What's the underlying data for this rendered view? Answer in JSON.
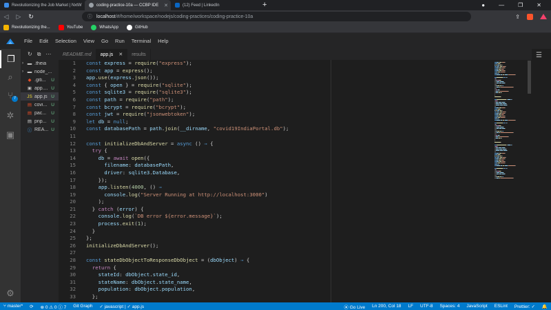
{
  "browser": {
    "tabs": [
      {
        "label": "Revolutionizing the Job Market | NxtW",
        "active": false
      },
      {
        "label": "coding-practice-10a — CCBP IDE",
        "active": true
      },
      {
        "label": "(12) Feed | LinkedIn",
        "active": false
      }
    ],
    "new_tab": "+",
    "url_host": "localhost",
    "url_path": "/#/home/workspace/nodejs/coding-practices/coding-practice-10a",
    "bookmarks": [
      {
        "label": "Revolutionizing the...",
        "color": "#f4b400"
      },
      {
        "label": "YouTube",
        "color": "#ff0000"
      },
      {
        "label": "WhatsApp",
        "color": "#25d366"
      },
      {
        "label": "GitHub",
        "color": "#ffffff"
      }
    ]
  },
  "ide": {
    "menu": [
      "File",
      "Edit",
      "Selection",
      "View",
      "Go",
      "Run",
      "Terminal",
      "Help"
    ],
    "activity_badge": "7",
    "explorer_items": [
      {
        "label": ".theia",
        "status": "",
        "type": "folder",
        "icon_color": "#c5c5c5"
      },
      {
        "label": "node_...",
        "status": "",
        "type": "folder",
        "icon_color": "#c5c5c5"
      },
      {
        "label": ".giti...",
        "status": "U",
        "type": "file",
        "icon": "◆",
        "icon_color": "#e44d26"
      },
      {
        "label": "app....",
        "status": "U",
        "type": "file",
        "icon": "▣",
        "icon_color": "#c5c5c5"
      },
      {
        "label": "app.js",
        "status": "U",
        "type": "file",
        "icon": "JS",
        "icon_color": "#f1dd35",
        "selected": true
      },
      {
        "label": "covi...",
        "status": "U",
        "type": "file",
        "icon": "▤",
        "icon_color": "#e44d26"
      },
      {
        "label": "pac...",
        "status": "U",
        "type": "file",
        "icon": "▤",
        "icon_color": "#e44d26"
      },
      {
        "label": "pnp...",
        "status": "U",
        "type": "file",
        "icon": "▤",
        "icon_color": "#c5c5c5"
      },
      {
        "label": "REA...",
        "status": "U",
        "type": "file",
        "icon": "ⓘ",
        "icon_color": "#42a5f5"
      }
    ],
    "editor_tabs": [
      {
        "label": "README.md",
        "active": false,
        "italic": true
      },
      {
        "label": "app.js",
        "active": true,
        "italic": false
      },
      {
        "label": "results",
        "active": false,
        "italic": false
      }
    ],
    "code_lines": [
      [
        [
          "k",
          "const "
        ],
        [
          "v",
          "express"
        ],
        [
          "p",
          " = "
        ],
        [
          "f",
          "require"
        ],
        [
          "p",
          "("
        ],
        [
          "s",
          "\"express\""
        ],
        [
          "p",
          ");"
        ]
      ],
      [
        [
          "k",
          "const "
        ],
        [
          "v",
          "app"
        ],
        [
          "p",
          " = "
        ],
        [
          "f",
          "express"
        ],
        [
          "p",
          "();"
        ]
      ],
      [
        [
          "v",
          "app"
        ],
        [
          "p",
          "."
        ],
        [
          "f",
          "use"
        ],
        [
          "p",
          "("
        ],
        [
          "v",
          "express"
        ],
        [
          "p",
          "."
        ],
        [
          "f",
          "json"
        ],
        [
          "p",
          "());"
        ]
      ],
      [
        [
          "k",
          "const "
        ],
        [
          "p",
          "{ "
        ],
        [
          "v",
          "open"
        ],
        [
          "p",
          " } = "
        ],
        [
          "f",
          "require"
        ],
        [
          "p",
          "("
        ],
        [
          "s",
          "\"sqlite\""
        ],
        [
          "p",
          ");"
        ]
      ],
      [
        [
          "k",
          "const "
        ],
        [
          "v",
          "sqlite3"
        ],
        [
          "p",
          " = "
        ],
        [
          "f",
          "require"
        ],
        [
          "p",
          "("
        ],
        [
          "s",
          "\"sqlite3\""
        ],
        [
          "p",
          ");"
        ]
      ],
      [
        [
          "k",
          "const "
        ],
        [
          "v",
          "path"
        ],
        [
          "p",
          " = "
        ],
        [
          "f",
          "require"
        ],
        [
          "p",
          "("
        ],
        [
          "s",
          "\"path\""
        ],
        [
          "p",
          ");"
        ]
      ],
      [
        [
          "k",
          "const "
        ],
        [
          "v",
          "bcrypt"
        ],
        [
          "p",
          " = "
        ],
        [
          "f",
          "require"
        ],
        [
          "p",
          "("
        ],
        [
          "s",
          "\"bcrypt\""
        ],
        [
          "p",
          ");"
        ]
      ],
      [
        [
          "k",
          "const "
        ],
        [
          "v",
          "jwt"
        ],
        [
          "p",
          " = "
        ],
        [
          "f",
          "require"
        ],
        [
          "p",
          "("
        ],
        [
          "s",
          "\"jsonwebtoken\""
        ],
        [
          "p",
          ");"
        ]
      ],
      [
        [
          "k",
          "let "
        ],
        [
          "v",
          "db"
        ],
        [
          "p",
          " = "
        ],
        [
          "k",
          "null"
        ],
        [
          "p",
          ";"
        ]
      ],
      [
        [
          "k",
          "const "
        ],
        [
          "v",
          "databasePath"
        ],
        [
          "p",
          " = "
        ],
        [
          "v",
          "path"
        ],
        [
          "p",
          "."
        ],
        [
          "f",
          "join"
        ],
        [
          "p",
          "("
        ],
        [
          "v",
          "__dirname"
        ],
        [
          "p",
          ", "
        ],
        [
          "s",
          "\"covid19IndiaPortal.db\""
        ],
        [
          "p",
          ");"
        ]
      ],
      [],
      [
        [
          "k",
          "const "
        ],
        [
          "f",
          "initializeDbAndServer"
        ],
        [
          "p",
          " = "
        ],
        [
          "k",
          "async"
        ],
        [
          "p",
          " () "
        ],
        [
          "k",
          "⇒"
        ],
        [
          "p",
          " {"
        ]
      ],
      [
        [
          "p",
          "  "
        ],
        [
          "kc",
          "try"
        ],
        [
          "p",
          " {"
        ]
      ],
      [
        [
          "p",
          "    "
        ],
        [
          "v",
          "db"
        ],
        [
          "p",
          " = "
        ],
        [
          "kc",
          "await "
        ],
        [
          "f",
          "open"
        ],
        [
          "p",
          "({"
        ]
      ],
      [
        [
          "p",
          "      "
        ],
        [
          "v",
          "filename"
        ],
        [
          "p",
          ": "
        ],
        [
          "v",
          "databasePath"
        ],
        [
          "p",
          ","
        ]
      ],
      [
        [
          "p",
          "      "
        ],
        [
          "v",
          "driver"
        ],
        [
          "p",
          ": "
        ],
        [
          "v",
          "sqlite3"
        ],
        [
          "p",
          "."
        ],
        [
          "v",
          "Database"
        ],
        [
          "p",
          ","
        ]
      ],
      [
        [
          "p",
          "    });"
        ]
      ],
      [
        [
          "p",
          "    "
        ],
        [
          "v",
          "app"
        ],
        [
          "p",
          "."
        ],
        [
          "f",
          "listen"
        ],
        [
          "p",
          "("
        ],
        [
          "n",
          "4000"
        ],
        [
          "p",
          ", () "
        ],
        [
          "k",
          "⇒"
        ]
      ],
      [
        [
          "p",
          "      "
        ],
        [
          "v",
          "console"
        ],
        [
          "p",
          "."
        ],
        [
          "f",
          "log"
        ],
        [
          "p",
          "("
        ],
        [
          "s",
          "\"Server Running at http://localhost:3000\""
        ],
        [
          "p",
          ")"
        ]
      ],
      [
        [
          "p",
          "    );"
        ]
      ],
      [
        [
          "p",
          "  } "
        ],
        [
          "kc",
          "catch"
        ],
        [
          "p",
          " ("
        ],
        [
          "v",
          "error"
        ],
        [
          "p",
          ") {"
        ]
      ],
      [
        [
          "p",
          "    "
        ],
        [
          "v",
          "console"
        ],
        [
          "p",
          "."
        ],
        [
          "f",
          "log"
        ],
        [
          "p",
          "("
        ],
        [
          "s",
          "`DB error ${error.message}`"
        ],
        [
          "p",
          ");"
        ]
      ],
      [
        [
          "p",
          "    "
        ],
        [
          "v",
          "process"
        ],
        [
          "p",
          "."
        ],
        [
          "f",
          "exit"
        ],
        [
          "p",
          "("
        ],
        [
          "n",
          "1"
        ],
        [
          "p",
          ");"
        ]
      ],
      [
        [
          "p",
          "  }"
        ]
      ],
      [
        [
          "p",
          "};"
        ]
      ],
      [
        [
          "f",
          "initializeDbAndServer"
        ],
        [
          "p",
          "();"
        ]
      ],
      [],
      [
        [
          "k",
          "const "
        ],
        [
          "f",
          "stateDbObjectToResponseDbObject"
        ],
        [
          "p",
          " = ("
        ],
        [
          "v",
          "dbObject"
        ],
        [
          "p",
          ") "
        ],
        [
          "k",
          "⇒"
        ],
        [
          "p",
          " {"
        ]
      ],
      [
        [
          "p",
          "  "
        ],
        [
          "kc",
          "return"
        ],
        [
          "p",
          " {"
        ]
      ],
      [
        [
          "p",
          "    "
        ],
        [
          "v",
          "stateId"
        ],
        [
          "p",
          ": "
        ],
        [
          "v",
          "dbObject"
        ],
        [
          "p",
          "."
        ],
        [
          "v",
          "state_id"
        ],
        [
          "p",
          ","
        ]
      ],
      [
        [
          "p",
          "    "
        ],
        [
          "v",
          "stateName"
        ],
        [
          "p",
          ": "
        ],
        [
          "v",
          "dbObject"
        ],
        [
          "p",
          "."
        ],
        [
          "v",
          "state_name"
        ],
        [
          "p",
          ","
        ]
      ],
      [
        [
          "p",
          "    "
        ],
        [
          "v",
          "population"
        ],
        [
          "p",
          ": "
        ],
        [
          "v",
          "dbObject"
        ],
        [
          "p",
          "."
        ],
        [
          "v",
          "population"
        ],
        [
          "p",
          ","
        ]
      ],
      [
        [
          "p",
          "  };"
        ]
      ]
    ]
  },
  "status": {
    "branch": "master*",
    "sync": "⟳",
    "errors": "0",
    "warnings": "0",
    "info": "7",
    "git_graph": "Git Graph",
    "language_check": "✓ javascript | ✓ app.js",
    "go_live": "Go Live",
    "position": "Ln 200, Col 18",
    "eol": "LF",
    "encoding": "UTF-8",
    "spaces": "Spaces: 4",
    "language": "JavaScript",
    "eslint": "ESLint",
    "prettier": "Prettier: ✓"
  },
  "colors": {
    "accent": "#007acc",
    "editor_bg": "#1e1e1e"
  }
}
